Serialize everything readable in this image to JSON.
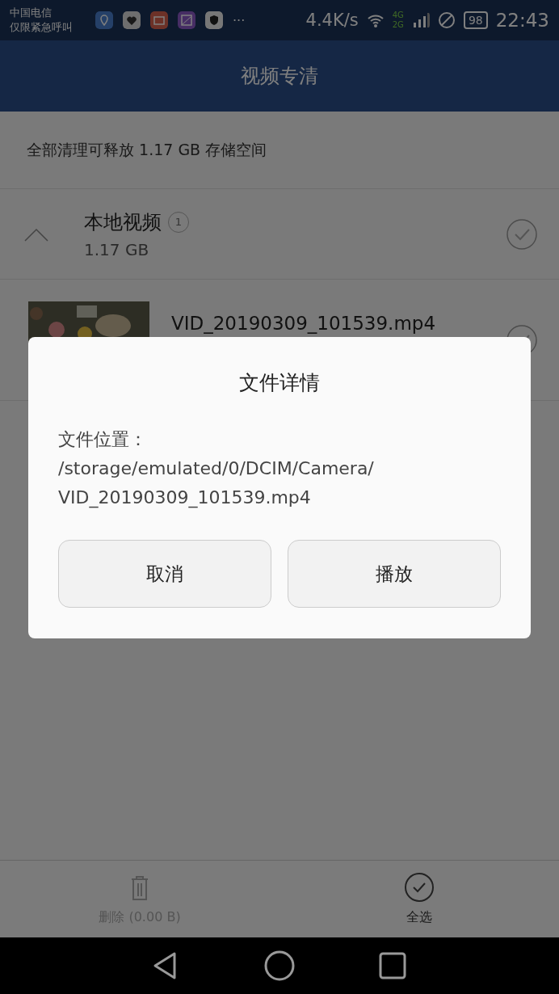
{
  "status_bar": {
    "carrier": "中国电信",
    "carrier_note": "仅限紧急呼叫",
    "speed": "4.4K/s",
    "network_top": "4G",
    "network_bottom": "2G",
    "battery": "98",
    "time": "22:43",
    "more": "···"
  },
  "app_bar": {
    "title": "视频专清"
  },
  "summary": "全部清理可释放 1.17 GB 存储空间",
  "group": {
    "title": "本地视频",
    "count": "1",
    "size": "1.17 GB",
    "expanded": true,
    "checked": false
  },
  "files": [
    {
      "name": "VID_20190309_101539.mp4",
      "checked": false
    }
  ],
  "bottom_bar": {
    "actions": [
      {
        "kind": "delete",
        "label": "删除 (0.00 B)",
        "disabled": true
      },
      {
        "kind": "select_all",
        "label": "全选",
        "disabled": false
      }
    ]
  },
  "dialog": {
    "title": "文件详情",
    "label": "文件位置：",
    "path_lines": [
      "/storage/emulated/0/DCIM/Camera/",
      "VID_20190309_101539.mp4"
    ],
    "buttons": [
      "取消",
      "播放"
    ]
  }
}
